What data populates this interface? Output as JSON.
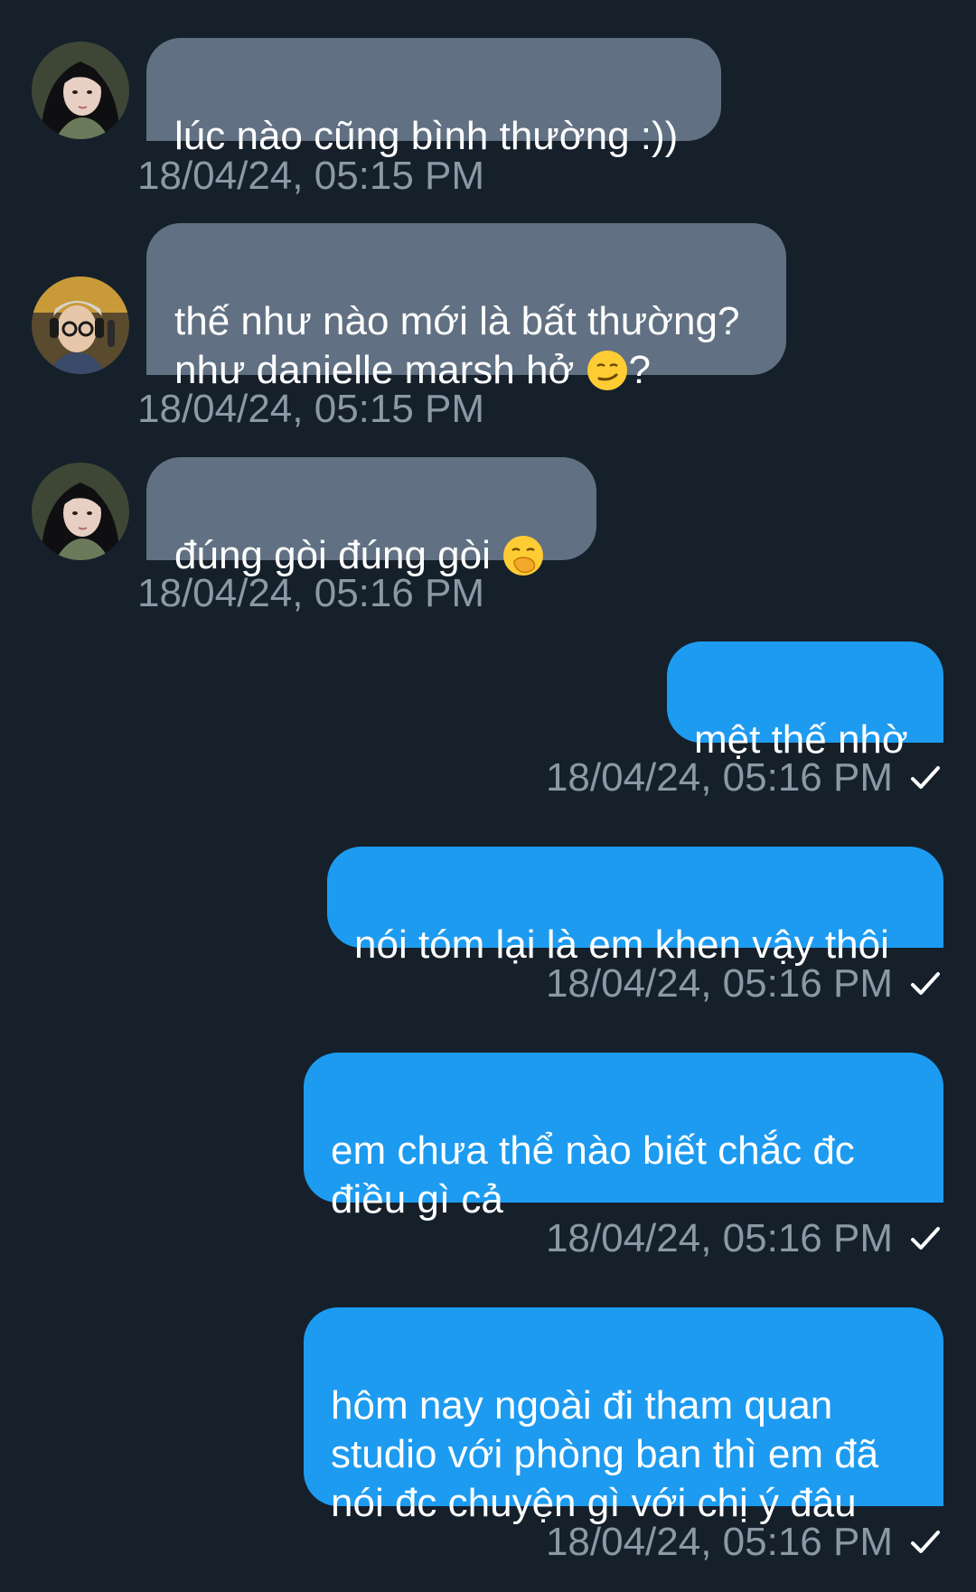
{
  "messages": [
    {
      "direction": "in",
      "avatar": "avatar-female-long-hair",
      "text": "lúc nào cũng bình thường :))",
      "timestamp": "18/04/24, 05:15 PM"
    },
    {
      "direction": "in",
      "avatar": "avatar-headphones-glasses",
      "text_before_emoji": "thế như nào mới là bất thường?\nnhư danielle marsh hở ",
      "emoji": "smirking-face-emoji",
      "text_after_emoji": "?",
      "timestamp": "18/04/24, 05:15 PM"
    },
    {
      "direction": "in",
      "avatar": "avatar-female-long-hair",
      "text_before_emoji": "đúng gòi đúng gòi ",
      "emoji": "face-with-hand-over-mouth-emoji",
      "timestamp": "18/04/24, 05:16 PM"
    },
    {
      "direction": "out",
      "text": "mệt thế nhờ",
      "timestamp": "18/04/24, 05:16 PM",
      "status_icon": "sent-check-icon"
    },
    {
      "direction": "out",
      "text": "nói tóm lại là em khen vậy thôi",
      "timestamp": "18/04/24, 05:16 PM",
      "status_icon": "sent-check-icon"
    },
    {
      "direction": "out",
      "text": "em chưa thể nào biết chắc đc\nđiều gì cả",
      "timestamp": "18/04/24, 05:16 PM",
      "status_icon": "sent-check-icon"
    },
    {
      "direction": "out",
      "text": "hôm nay ngoài đi tham quan\nstudio với phòng ban thì em đã\nnói đc chuyện gì với chị ý đâu",
      "timestamp": "18/04/24, 05:16 PM",
      "status_icon": "sent-check-icon"
    }
  ],
  "colors": {
    "background": "#15202b",
    "incoming_bubble": "#617183",
    "outgoing_bubble": "#1d9bf0",
    "timestamp": "#8b98a5",
    "text": "#ffffff"
  }
}
